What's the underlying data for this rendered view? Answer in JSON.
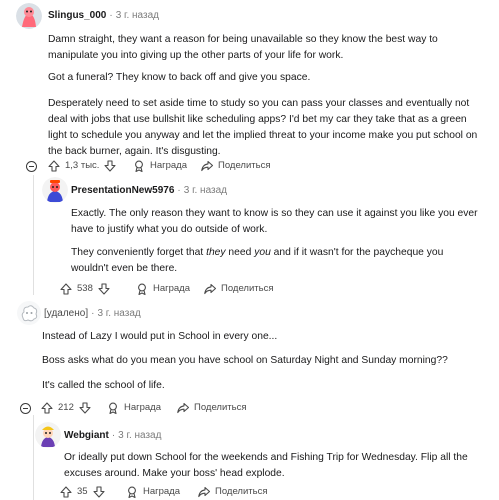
{
  "comments": [
    {
      "username": "Slingus_000",
      "time": "3 г. назад",
      "paragraphs": [
        [
          "Damn straight, they want a reason for being unavailable so they know the best way to",
          "manipulate you into giving up the other parts of your life for work."
        ],
        [
          "Got a funeral? They know to back off and give you space."
        ],
        [
          "Desperately need to set aside time to study so you can pass your classes and eventually not",
          "deal with jobs that use bullshit like scheduling apps? I'd bet my car they take that as a green",
          "light to schedule you anyway and let the implied threat to your income make you put school on",
          "the back burner, again. It's disgusting."
        ]
      ],
      "votes": "1,3 тыс.",
      "award": "Награда",
      "share": "Поделиться"
    },
    {
      "username": "PresentationNew5976",
      "time": "3 г. назад",
      "paragraphs": [
        [
          "Exactly. The only reason they want to know is so they can use it against you like you ever",
          "have to justify what you do outside of work."
        ],
        {
          "line1": [
            "They conveniently forget that ",
            "they",
            " need ",
            "you",
            " and if it wasn't for the paycheque you"
          ],
          "line2": "wouldn't even be there."
        }
      ],
      "votes": "538",
      "award": "Награда",
      "share": "Поделиться"
    },
    {
      "username": "[удалено]",
      "time": "3 г. назад",
      "paragraphs": [
        [
          "Instead of Lazy I would put in School in every one..."
        ],
        [
          "Boss asks what do you mean you have school on Saturday Night and Sunday morning??"
        ],
        [
          "It's called the school of life."
        ]
      ],
      "votes": "212",
      "award": "Награда",
      "share": "Поделиться"
    },
    {
      "username": "Webgiant",
      "time": "3 г. назад",
      "paragraphs": [
        [
          "Or ideally put down School for the weekends and Fishing Trip for Wednesday. Flip all the",
          "excuses around. Make your boss' head explode."
        ]
      ],
      "votes": "35",
      "award": "Награда",
      "share": "Поделиться"
    }
  ]
}
